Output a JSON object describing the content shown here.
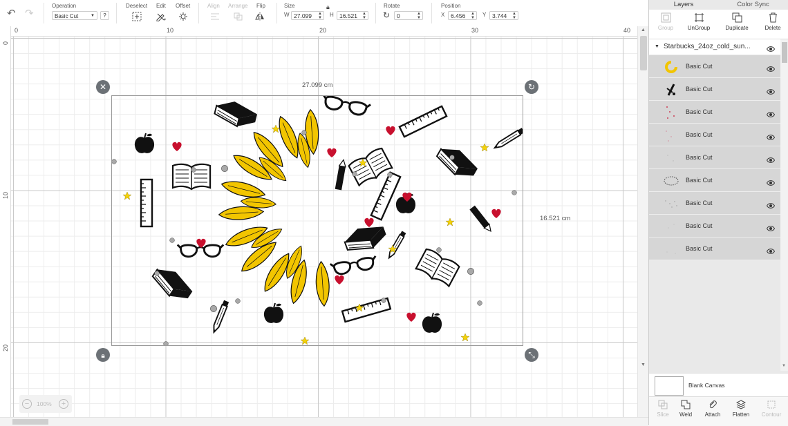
{
  "toolbar": {
    "operation": {
      "label": "Operation",
      "value": "Basic Cut",
      "help": "?"
    },
    "deselect": {
      "label": "Deselect"
    },
    "edit": {
      "label": "Edit"
    },
    "offset": {
      "label": "Offset"
    },
    "align": {
      "label": "Align"
    },
    "arrange": {
      "label": "Arrange"
    },
    "flip": {
      "label": "Flip"
    },
    "size": {
      "label": "Size",
      "w_label": "W",
      "w_value": "27.099",
      "h_label": "H",
      "h_value": "16.521"
    },
    "rotate": {
      "label": "Rotate",
      "value": "0"
    },
    "position": {
      "label": "Position",
      "x_label": "X",
      "x_value": "6.456",
      "y_label": "Y",
      "y_value": "3.744"
    }
  },
  "ruler": {
    "top": [
      "0",
      "10",
      "20",
      "30",
      "40"
    ],
    "left": [
      "0",
      "10",
      "20"
    ]
  },
  "canvas": {
    "width_label": "27.099 cm",
    "height_label": "16.521 cm",
    "zoom": "100%",
    "zoom_out": "−",
    "zoom_in": "+"
  },
  "panel": {
    "tabs": [
      "Layers",
      "Color Sync"
    ],
    "actions": [
      "Group",
      "UnGroup",
      "Duplicate",
      "Delete"
    ],
    "group_name": "Starbucks_24oz_cold_sun...",
    "layers": [
      {
        "name": "Basic Cut",
        "thumb": "sunflower"
      },
      {
        "name": "Basic Cut",
        "thumb": "pencils"
      },
      {
        "name": "Basic Cut",
        "thumb": "red-dots"
      },
      {
        "name": "Basic Cut",
        "thumb": "pink-dots"
      },
      {
        "name": "Basic Cut",
        "thumb": "faint-dots"
      },
      {
        "name": "Basic Cut",
        "thumb": "dotted-ring"
      },
      {
        "name": "Basic Cut",
        "thumb": "scatter"
      },
      {
        "name": "Basic Cut",
        "thumb": "faint"
      },
      {
        "name": "Basic Cut",
        "thumb": "faint"
      }
    ],
    "blank_canvas": "Blank Canvas",
    "bottom_actions": [
      "Slice",
      "Weld",
      "Attach",
      "Flatten",
      "Contour"
    ]
  },
  "colors": {
    "petal": "#f2c500",
    "heart": "#c8102e",
    "star": "#f4d20a",
    "dot": "#a9a9a9",
    "ink": "#111111"
  }
}
